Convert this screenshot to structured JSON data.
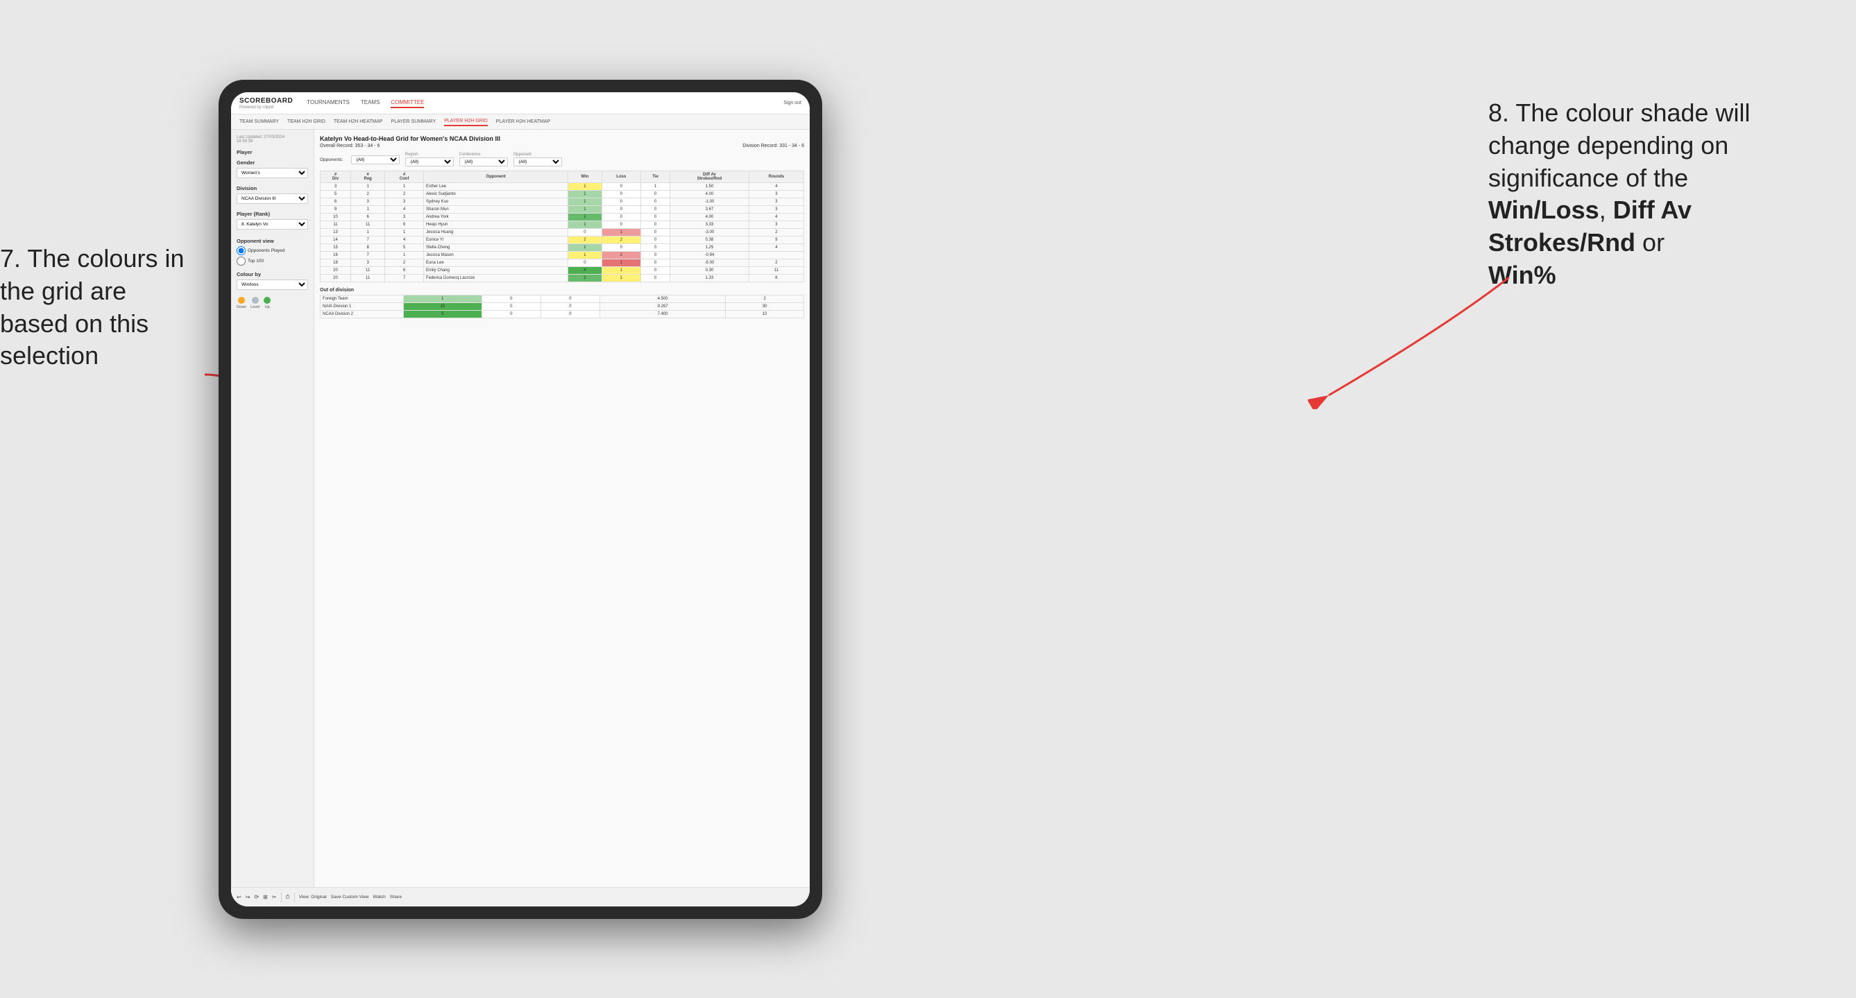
{
  "annotations": {
    "left_title": "7. The colours in the grid are based on this selection",
    "right_title": "8. The colour shade will change depending on significance of the",
    "right_bold1": "Win/Loss",
    "right_comma": ", ",
    "right_bold2": "Diff Av Strokes/Rnd",
    "right_or": " or",
    "right_bold3": "Win%"
  },
  "nav": {
    "logo": "SCOREBOARD",
    "logo_sub": "Powered by clippd",
    "items": [
      "TOURNAMENTS",
      "TEAMS",
      "COMMITTEE"
    ],
    "active_item": "COMMITTEE",
    "right_items": [
      "Sign out"
    ]
  },
  "sub_nav": {
    "items": [
      "TEAM SUMMARY",
      "TEAM H2H GRID",
      "TEAM H2H HEATMAP",
      "PLAYER SUMMARY",
      "PLAYER H2H GRID",
      "PLAYER H2H HEATMAP"
    ],
    "active_item": "PLAYER H2H GRID"
  },
  "left_panel": {
    "last_updated_label": "Last Updated: 27/03/2024",
    "last_updated_time": "16:55:38",
    "player_label": "Player",
    "gender_label": "Gender",
    "gender_value": "Women's",
    "division_label": "Division",
    "division_value": "NCAA Division III",
    "player_rank_label": "Player (Rank)",
    "player_rank_value": "8. Katelyn Vo",
    "opponent_view_label": "Opponent view",
    "radio1": "Opponents Played",
    "radio2": "Top 100",
    "colour_by_label": "Colour by",
    "colour_by_value": "Win/loss",
    "legend": [
      {
        "label": "Down",
        "color": "#f9a825"
      },
      {
        "label": "Level",
        "color": "#b0bec5"
      },
      {
        "label": "Up",
        "color": "#4caf50"
      }
    ]
  },
  "grid": {
    "title": "Katelyn Vo Head-to-Head Grid for Women's NCAA Division III",
    "overall_record_label": "Overall Record:",
    "overall_record_value": "353 - 34 - 6",
    "division_record_label": "Division Record:",
    "division_record_value": "331 - 34 - 6",
    "filter_opponents_label": "Opponents:",
    "filter_opponents_value": "(All)",
    "filter_region_label": "Region",
    "filter_region_value": "(All)",
    "filter_conference_label": "Conference",
    "filter_conference_value": "(All)",
    "filter_opponent_label": "Opponent",
    "filter_opponent_value": "(All)",
    "table_headers": [
      "#\nDiv",
      "#\nReg",
      "#\nConf",
      "Opponent",
      "Win",
      "Loss",
      "Tie",
      "Diff Av\nStrokes/Rnd",
      "Rounds"
    ],
    "rows": [
      {
        "div": "3",
        "reg": "1",
        "conf": "1",
        "opponent": "Esther Lee",
        "win": "1",
        "loss": "0",
        "tie": "1",
        "diff": "1.50",
        "rounds": "4",
        "win_color": "yellow",
        "loss_color": "white",
        "tie_color": "white"
      },
      {
        "div": "5",
        "reg": "2",
        "conf": "2",
        "opponent": "Alexis Sudjianto",
        "win": "1",
        "loss": "0",
        "tie": "0",
        "diff": "4.00",
        "rounds": "3",
        "win_color": "green-light",
        "loss_color": "white",
        "tie_color": "white"
      },
      {
        "div": "6",
        "reg": "3",
        "conf": "3",
        "opponent": "Sydney Kuo",
        "win": "1",
        "loss": "0",
        "tie": "0",
        "diff": "-1.00",
        "rounds": "3",
        "win_color": "green-light",
        "loss_color": "white",
        "tie_color": "white"
      },
      {
        "div": "9",
        "reg": "1",
        "conf": "4",
        "opponent": "Sharon Mun",
        "win": "1",
        "loss": "0",
        "tie": "0",
        "diff": "3.67",
        "rounds": "3",
        "win_color": "green-light",
        "loss_color": "white",
        "tie_color": "white"
      },
      {
        "div": "10",
        "reg": "6",
        "conf": "3",
        "opponent": "Andrea York",
        "win": "2",
        "loss": "0",
        "tie": "0",
        "diff": "4.00",
        "rounds": "4",
        "win_color": "green-med",
        "loss_color": "white",
        "tie_color": "white"
      },
      {
        "div": "11",
        "reg": "11",
        "conf": "6",
        "opponent": "Heejo Hyun",
        "win": "1",
        "loss": "0",
        "tie": "0",
        "diff": "3.33",
        "rounds": "3",
        "win_color": "green-light",
        "loss_color": "white",
        "tie_color": "white"
      },
      {
        "div": "13",
        "reg": "1",
        "conf": "1",
        "opponent": "Jessica Huang",
        "win": "0",
        "loss": "1",
        "tie": "0",
        "diff": "-3.00",
        "rounds": "2",
        "win_color": "white",
        "loss_color": "red-light",
        "tie_color": "white"
      },
      {
        "div": "14",
        "reg": "7",
        "conf": "4",
        "opponent": "Eunice Yi",
        "win": "2",
        "loss": "2",
        "tie": "0",
        "diff": "0.38",
        "rounds": "9",
        "win_color": "yellow",
        "loss_color": "yellow",
        "tie_color": "white"
      },
      {
        "div": "15",
        "reg": "8",
        "conf": "5",
        "opponent": "Stella Cheng",
        "win": "1",
        "loss": "0",
        "tie": "0",
        "diff": "1.25",
        "rounds": "4",
        "win_color": "green-light",
        "loss_color": "white",
        "tie_color": "white"
      },
      {
        "div": "16",
        "reg": "7",
        "conf": "1",
        "opponent": "Jessica Mason",
        "win": "1",
        "loss": "2",
        "tie": "0",
        "diff": "-0.94",
        "rounds": "",
        "win_color": "yellow",
        "loss_color": "red-light",
        "tie_color": "white"
      },
      {
        "div": "18",
        "reg": "3",
        "conf": "2",
        "opponent": "Euna Lee",
        "win": "0",
        "loss": "1",
        "tie": "0",
        "diff": "-5.00",
        "rounds": "2",
        "win_color": "white",
        "loss_color": "red",
        "tie_color": "white"
      },
      {
        "div": "20",
        "reg": "11",
        "conf": "6",
        "opponent": "Emily Chang",
        "win": "4",
        "loss": "1",
        "tie": "0",
        "diff": "0.30",
        "rounds": "11",
        "win_color": "green-dark",
        "loss_color": "yellow",
        "tie_color": "white"
      },
      {
        "div": "20",
        "reg": "11",
        "conf": "7",
        "opponent": "Federica Domecq Lacroze",
        "win": "2",
        "loss": "1",
        "tie": "0",
        "diff": "1.33",
        "rounds": "6",
        "win_color": "green-med",
        "loss_color": "yellow",
        "tie_color": "white"
      }
    ],
    "out_of_division_label": "Out of division",
    "out_of_division_rows": [
      {
        "opponent": "Foreign Team",
        "win": "1",
        "loss": "0",
        "tie": "0",
        "diff": "4.500",
        "rounds": "2",
        "win_color": "green-light"
      },
      {
        "opponent": "NAIA Division 1",
        "win": "15",
        "loss": "0",
        "tie": "0",
        "diff": "9.267",
        "rounds": "30",
        "win_color": "green-dark"
      },
      {
        "opponent": "NCAA Division 2",
        "win": "5",
        "loss": "0",
        "tie": "0",
        "diff": "7.400",
        "rounds": "10",
        "win_color": "green-dark"
      }
    ]
  },
  "toolbar": {
    "view_original": "View: Original",
    "save_custom": "Save Custom View",
    "watch": "Watch",
    "share": "Share"
  }
}
